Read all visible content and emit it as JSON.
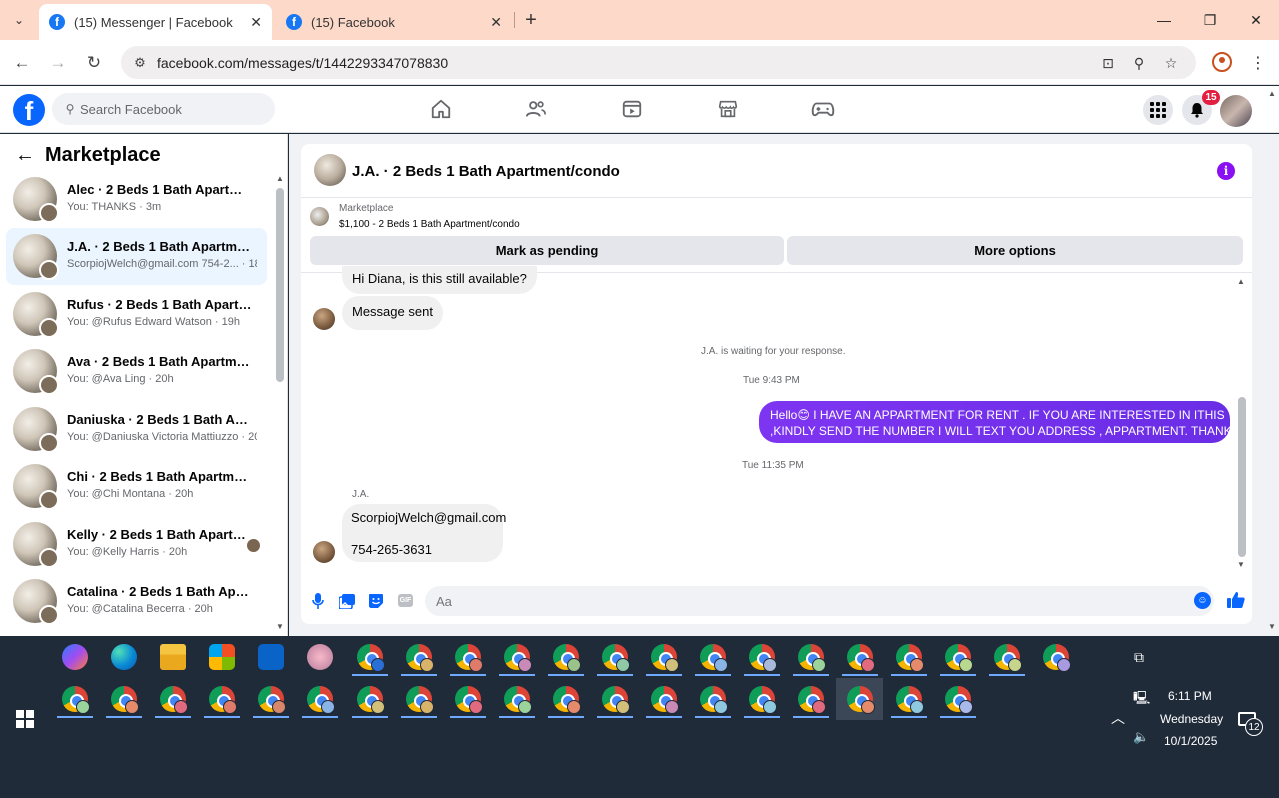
{
  "browser": {
    "tabs": [
      {
        "title": "(15) Messenger | Facebook",
        "active": true
      },
      {
        "title": "(15) Facebook",
        "active": false
      }
    ],
    "url": "facebook.com/messages/t/1442293347078830",
    "controls": {
      "minimize": "—",
      "restore": "❐",
      "close": "✕"
    }
  },
  "fb": {
    "search_placeholder": "Search Facebook",
    "notif_count": "15",
    "nav_icons": [
      "home-icon",
      "friends-icon",
      "video-icon",
      "marketplace-icon",
      "gaming-icon"
    ]
  },
  "sidebar": {
    "title": "Marketplace",
    "conversations": [
      {
        "name": "Alec · 2 Beds 1 Bath Apartment/...",
        "sub": "You: THANKS · 3m",
        "selected": false
      },
      {
        "name": "J.A. · 2 Beds 1 Bath Apartment/c...",
        "sub": "ScorpiojWelch@gmail.com 754-2... · 18h",
        "selected": true
      },
      {
        "name": "Rufus · 2 Beds 1 Bath Apartmen...",
        "sub": "You: @Rufus Edward Watson · 19h",
        "selected": false
      },
      {
        "name": "Ava · 2 Beds 1 Bath Apartment/...",
        "sub": "You: @Ava Ling · 20h",
        "selected": false
      },
      {
        "name": "Daniuska · 2 Beds 1 Bath Apart...",
        "sub": "You: @Daniuska Victoria Mattiuzzo · 20h",
        "selected": false
      },
      {
        "name": "Chi · 2 Beds 1 Bath Apartment/c...",
        "sub": "You: @Chi Montana · 20h",
        "selected": false
      },
      {
        "name": "Kelly · 2 Beds 1 Bath Apartme...",
        "sub": "You: @Kelly Harris · 20h",
        "selected": false
      },
      {
        "name": "Catalina · 2 Beds 1 Bath Apartm...",
        "sub": "You: @Catalina Becerra · 20h",
        "selected": false
      }
    ]
  },
  "chat": {
    "title": "J.A. · 2 Beds 1 Bath Apartment/condo",
    "listing_label": "Marketplace",
    "listing_price": "$1,100 - 2 Beds 1 Bath Apartment/condo",
    "btn_pending": "Mark as pending",
    "btn_more": "More options",
    "messages": {
      "m1": "Hi Diana, is this still available?",
      "m2": "Message sent",
      "waiting": "J.A. is waiting for your response.",
      "ts1": "Tue 9:43 PM",
      "out_line1": "Hello😊 I HAVE AN APPARTMENT  FOR RENT . IF YOU ARE INTERESTED IN ITHIS",
      "out_line2": ",KINDLY SEND THE NUMBER I WILL TEXT YOU ADDRESS , APPARTMENT. THANK YOU",
      "ts2": "Tue 11:35 PM",
      "sender": "J.A.",
      "reply_email": "ScorpiojWelch@gmail.com",
      "reply_phone": "754-265-3631"
    },
    "composer_placeholder": "Aa",
    "accent": "#7b2ef0"
  },
  "taskbar": {
    "time": "6:11 PM",
    "day": "Wednesday",
    "date": "10/1/2025",
    "notifications": "12"
  }
}
